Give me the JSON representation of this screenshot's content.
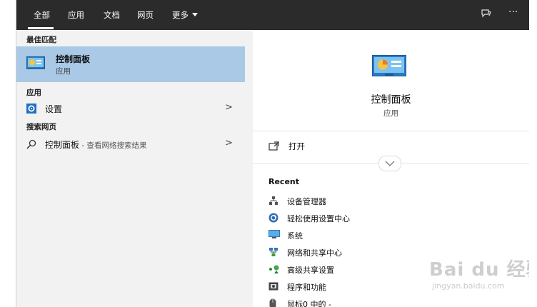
{
  "tabs": [
    {
      "label": "全部"
    },
    {
      "label": "应用"
    },
    {
      "label": "文档"
    },
    {
      "label": "网页"
    },
    {
      "label": "更多"
    }
  ],
  "top_icons": {
    "feedback": "feedback-icon",
    "more": "···"
  },
  "left": {
    "best_match_header": "最佳匹配",
    "best_match": {
      "title": "控制面板",
      "subtitle": "应用"
    },
    "apps_header": "应用",
    "apps": [
      {
        "label": "设置",
        "chevron": ">"
      }
    ],
    "web_header": "搜索网页",
    "web": [
      {
        "label": "控制面板",
        "suffix": " - 查看网络搜索结果",
        "chevron": ">"
      }
    ]
  },
  "right": {
    "title": "控制面板",
    "subtitle": "应用",
    "open_label": "打开",
    "recent_header": "Recent",
    "recent": [
      {
        "label": "设备管理器",
        "icon": "device-manager-icon"
      },
      {
        "label": "轻松使用设置中心",
        "icon": "ease-of-access-icon"
      },
      {
        "label": "系统",
        "icon": "system-icon"
      },
      {
        "label": "网络和共享中心",
        "icon": "network-icon"
      },
      {
        "label": "高级共享设置",
        "icon": "sharing-icon"
      },
      {
        "label": "程序和功能",
        "icon": "programs-icon"
      },
      {
        "label": "鼠标0 中的 -",
        "icon": "mouse-icon"
      }
    ]
  },
  "watermark": {
    "main": "Bai du 经验",
    "sub": "jingyan.baidu.com"
  }
}
